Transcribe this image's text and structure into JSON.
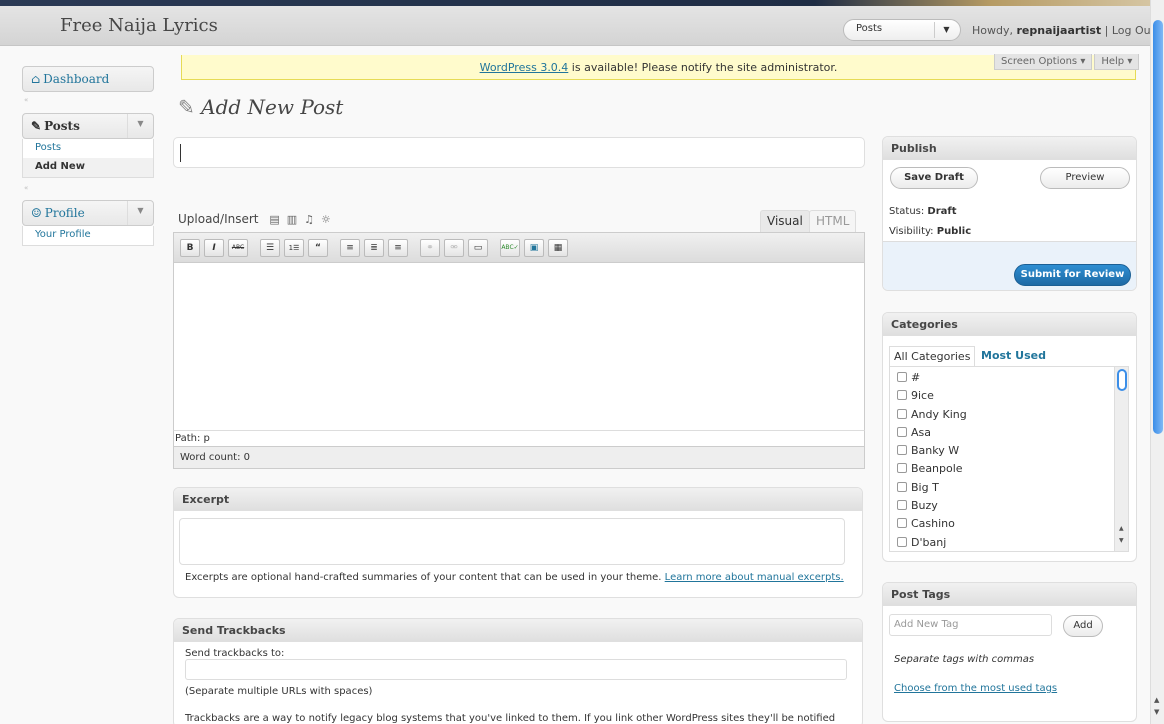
{
  "header": {
    "site_title": "Free Naija Lyrics",
    "favorites": {
      "selected": "Posts",
      "arrow": "▼"
    },
    "howdy_prefix": "Howdy, ",
    "username": "repnaijaartist",
    "divider": " | ",
    "logout": "Log Out"
  },
  "notice": {
    "link": "WordPress 3.0.4",
    "text": " is available! Please notify the site administrator."
  },
  "screen_tabs": {
    "screen_options": "Screen Options ▾",
    "help": "Help ▾"
  },
  "sidebar": {
    "dashboard": "Dashboard",
    "posts": "Posts",
    "posts_sub": [
      "Posts",
      "Add New"
    ],
    "profile": "Profile",
    "profile_sub": [
      "Your Profile"
    ],
    "toggle": "▼"
  },
  "page": {
    "title": "Add New Post"
  },
  "editor": {
    "upload_label": "Upload/Insert",
    "tab_visual": "Visual",
    "tab_html": "HTML",
    "path": "Path: p",
    "word_count": "Word count: 0",
    "toolbar": [
      "B",
      "I",
      "ABC",
      "☰",
      "1☰",
      "“",
      "≡",
      "≣",
      "≡",
      "⚭",
      "⚮",
      "▭",
      "ABC✓",
      "▣",
      "▦"
    ]
  },
  "excerpt": {
    "title": "Excerpt",
    "note": "Excerpts are optional hand-crafted summaries of your content that can be used in your theme. ",
    "link": "Learn more about manual excerpts."
  },
  "trackbacks": {
    "title": "Send Trackbacks",
    "label": "Send trackbacks to:",
    "hint": "(Separate multiple URLs with spaces)",
    "note": "Trackbacks are a way to notify legacy blog systems that you've linked to them. If you link other WordPress sites they'll be notified"
  },
  "publish": {
    "title": "Publish",
    "save_draft": "Save Draft",
    "preview": "Preview",
    "status_label": "Status: ",
    "status_value": "Draft",
    "visibility_label": "Visibility: ",
    "visibility_value": "Public",
    "submit": "Submit for Review"
  },
  "categories": {
    "title": "Categories",
    "tab_all": "All Categories",
    "tab_most_used": "Most Used",
    "items": [
      "#",
      "9ice",
      "Andy King",
      "Asa",
      "Banky W",
      "Beanpole",
      "Big T",
      "Buzy",
      "Cashino",
      "D'banj"
    ]
  },
  "tags": {
    "title": "Post Tags",
    "placeholder": "Add New Tag",
    "add": "Add",
    "note": "Separate tags with commas",
    "link": "Choose from the most used tags"
  }
}
